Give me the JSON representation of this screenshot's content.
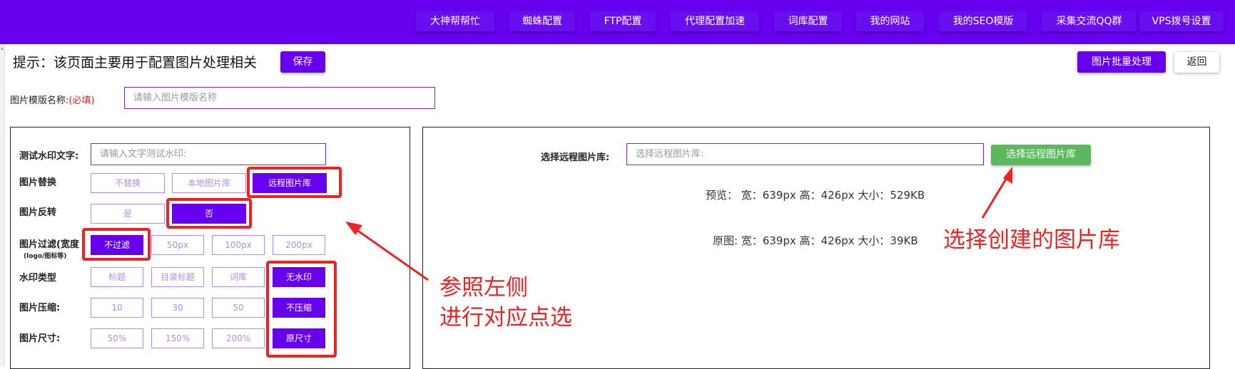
{
  "nav": {
    "items": [
      "大神帮帮忙",
      "蜘蛛配置",
      "FTP配置",
      "代理配置加速",
      "词库配置",
      "我的网站",
      "我的SEO模版",
      "采集交流QQ群",
      "VPS拨号设置"
    ]
  },
  "header": {
    "hint": "提示：该页面主要用于配置图片处理相关",
    "save_label": "保存",
    "batch_label": "图片批量处理",
    "back_label": "返回"
  },
  "template_name": {
    "label": "图片模版名称:",
    "required": "(必填)",
    "placeholder": "请输入图片模版名称"
  },
  "left_panel": {
    "watermark_text": {
      "label": "测试水印文字:",
      "placeholder": "请输入文字测试水印:"
    },
    "replace": {
      "label": "图片替换",
      "options": [
        "不替换",
        "本地图片库",
        "远程图片库"
      ]
    },
    "flip": {
      "label": "图片反转",
      "options": [
        "是",
        "否"
      ]
    },
    "filter": {
      "label": "图片过滤(宽度",
      "sublabel": "(logo/图标等)",
      "options": [
        "不过滤",
        "50px",
        "100px",
        "200px"
      ]
    },
    "watermark_type": {
      "label": "水印类型",
      "options": [
        "标题",
        "目录标题",
        "词库",
        "无水印"
      ]
    },
    "compress": {
      "label": "图片压缩:",
      "options": [
        "10",
        "30",
        "50",
        "不压缩"
      ]
    },
    "size": {
      "label": "图片尺寸:",
      "options": [
        "50%",
        "150%",
        "200%",
        "原尺寸"
      ]
    }
  },
  "right_panel": {
    "remote_label": "选择远程图片库:",
    "remote_placeholder": "选择远程图片库:",
    "remote_button": "选择远程图片库",
    "preview": "预览： 宽：639px 高：426px 大小：529KB",
    "original": "原图: 宽：639px 高：426px 大小：39KB"
  },
  "annotations": {
    "left_line1": "参照左侧",
    "left_line2": "进行对应点选",
    "right": "选择创建的图片库",
    "color": "#ee2222"
  },
  "colors": {
    "brand": "#6600ee",
    "green": "#5cb85c",
    "highlight": "#ee2222"
  }
}
